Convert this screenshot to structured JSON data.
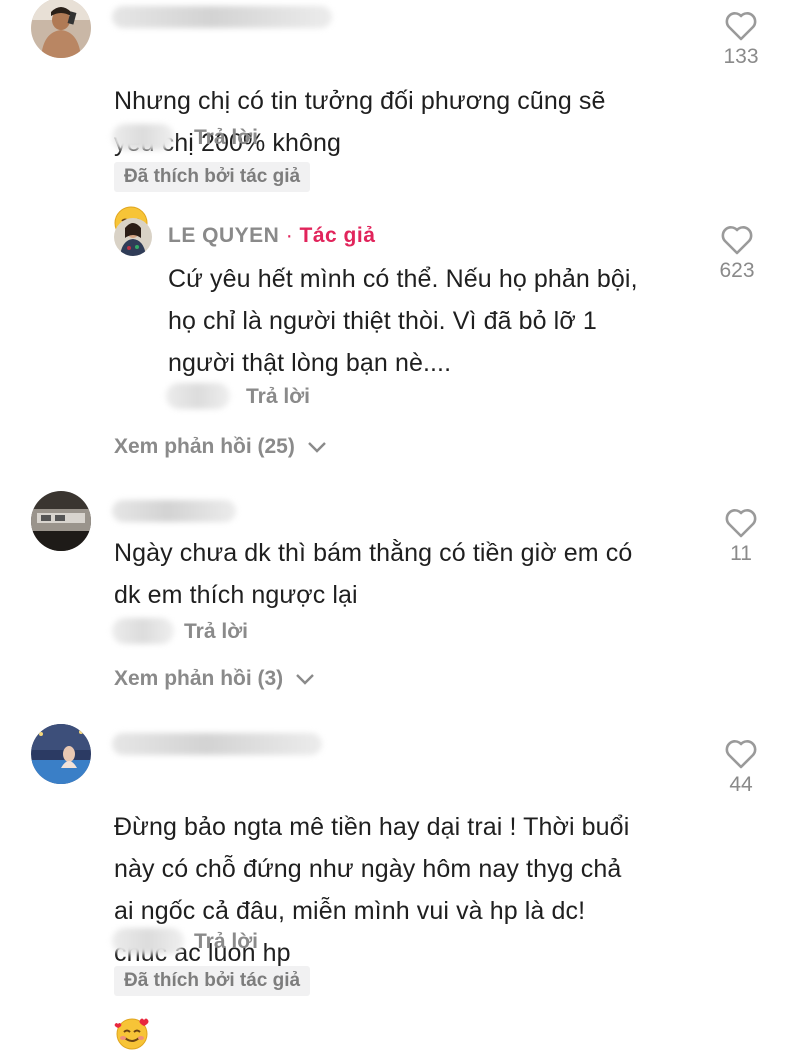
{
  "comments": [
    {
      "text_lines": "Nhưng chị có tin tưởng đối phương cũng sẽ\nyêu chị 200% không",
      "emoji": "relieved-face",
      "likes": "133",
      "reply_label": "Trả lời",
      "liked_by_author": "Đã thích bởi tác giả"
    },
    {
      "text_lines": "Ngày chưa dk thì bám thằng có tiền giờ em có\ndk em thích ngược lại",
      "likes": "11",
      "reply_label": "Trả lời",
      "view_replies": "Xem phản hồi (3)"
    },
    {
      "text_lines": "Đừng bảo ngta mê tiền hay dại trai ! Thời buổi\nnày có chỗ đứng như ngày hôm nay thyg chả\nai ngốc cả đâu, miễn mình vui và hp là dc!\nchúc ac luon hp",
      "emoji": "smiling-face-with-hearts",
      "likes": "44",
      "reply_label": "Trả lời",
      "liked_by_author": "Đã thích bởi tác giả"
    }
  ],
  "author_reply": {
    "name": "LE QUYEN",
    "separator": " · ",
    "tag": "Tác giả",
    "text_lines": "Cứ yêu hết mình có thể. Nếu họ phản bội,\nhọ chỉ là người thiệt thòi. Vì đã bỏ lỡ 1\nngười thật lòng bạn nè....",
    "likes": "623",
    "reply_label": "Trả lời"
  },
  "thread1_view_replies": "Xem phản hồi (25)",
  "icons": {
    "like": "heart-outline-icon",
    "expand": "chevron-down-icon"
  },
  "colors": {
    "author_tag": "#e1245b",
    "secondary_text": "#8a8a8a",
    "badge_bg": "#f1f1f2"
  }
}
